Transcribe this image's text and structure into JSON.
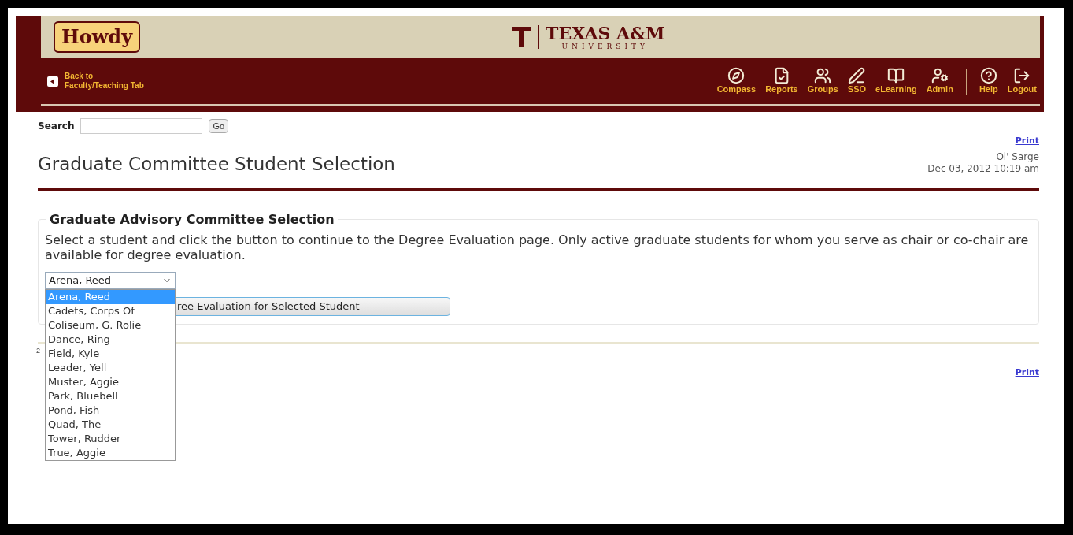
{
  "header": {
    "logo": "Howdy",
    "university": "TEXAS A&M",
    "university_sub": "UNIVERSITY",
    "back_link": [
      "Back to",
      "Faculty/Teaching Tab"
    ],
    "nav": [
      {
        "kind": "compass",
        "label": "Compass"
      },
      {
        "kind": "reports",
        "label": "Reports"
      },
      {
        "kind": "groups",
        "label": "Groups"
      },
      {
        "kind": "sso",
        "label": "SSO"
      },
      {
        "kind": "elearning",
        "label": "eLearning"
      },
      {
        "kind": "admin",
        "label": "Admin"
      },
      {
        "kind": "help",
        "label": "Help"
      },
      {
        "kind": "logout",
        "label": "Logout"
      }
    ]
  },
  "search": {
    "label": "Search",
    "button": "Go"
  },
  "page": {
    "title": "Graduate Committee Student Selection",
    "print_link": "Print",
    "user": "Ol' Sarge",
    "timestamp": "Dec 03, 2012 10:19 am"
  },
  "section": {
    "legend": "Graduate Advisory Committee Selection",
    "instructions": "Select a student and click the button to continue to the Degree Evaluation page. Only active graduate students for whom you serve as chair or co-chair are available for degree evaluation.",
    "select_value": "Arena, Reed",
    "button_visible_text": "ree Evaluation for Selected Student",
    "options": [
      {
        "label": "Arena, Reed",
        "selected": true
      },
      {
        "label": "Cadets, Corps Of",
        "selected": false
      },
      {
        "label": "Coliseum, G. Rolie",
        "selected": false
      },
      {
        "label": "Dance, Ring",
        "selected": false
      },
      {
        "label": "Field, Kyle",
        "selected": false
      },
      {
        "label": "Leader, Yell",
        "selected": false
      },
      {
        "label": "Muster, Aggie",
        "selected": false
      },
      {
        "label": "Park, Bluebell",
        "selected": false
      },
      {
        "label": "Pond, Fish",
        "selected": false
      },
      {
        "label": "Quad, The",
        "selected": false
      },
      {
        "label": "Tower, Rudder",
        "selected": false
      },
      {
        "label": "True, Aggie",
        "selected": false
      }
    ]
  },
  "footer": {
    "page_number": "2",
    "print_link": "Print"
  }
}
